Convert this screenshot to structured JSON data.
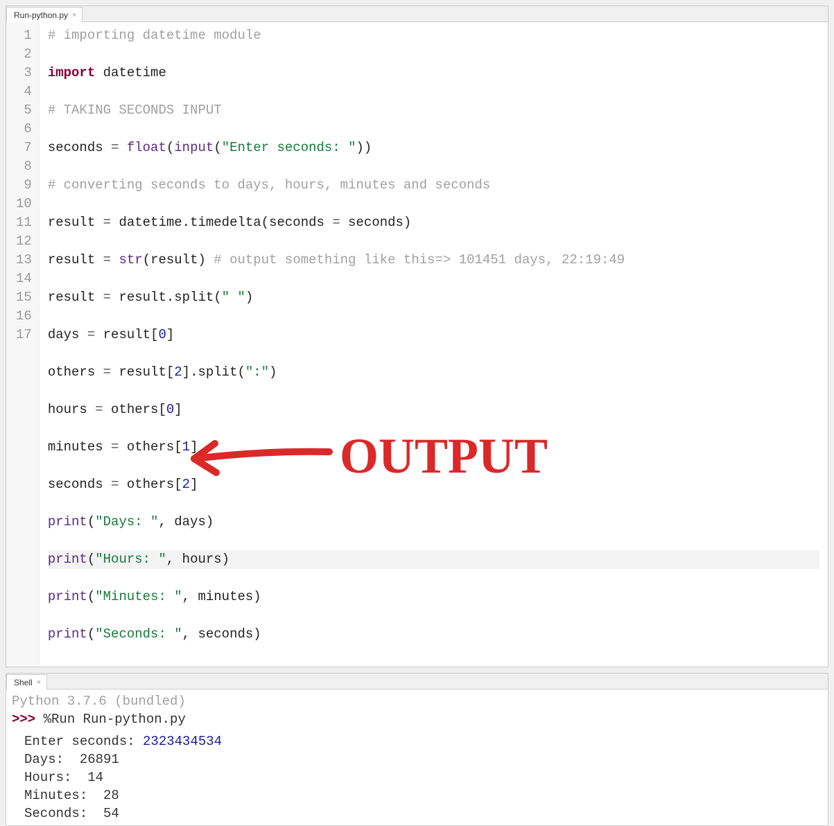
{
  "editor": {
    "tab_label": "Run-python.py",
    "tab_close": "×",
    "gutter": [
      "1",
      "2",
      "3",
      "4",
      "5",
      "6",
      "7",
      "8",
      "9",
      "10",
      "11",
      "12",
      "13",
      "14",
      "15",
      "16",
      "17"
    ],
    "lines": [
      {
        "t": [
          {
            "c": "c-comment",
            "v": "# importing datetime module"
          }
        ]
      },
      {
        "t": [
          {
            "c": "c-keyword",
            "v": "import"
          },
          {
            "c": "c-text",
            "v": " datetime"
          }
        ]
      },
      {
        "t": [
          {
            "c": "c-comment",
            "v": "# TAKING SECONDS INPUT"
          }
        ]
      },
      {
        "t": [
          {
            "c": "c-text",
            "v": "seconds "
          },
          {
            "c": "c-op",
            "v": "="
          },
          {
            "c": "c-text",
            "v": " "
          },
          {
            "c": "c-builtin",
            "v": "float"
          },
          {
            "c": "c-text",
            "v": "("
          },
          {
            "c": "c-builtin",
            "v": "input"
          },
          {
            "c": "c-text",
            "v": "("
          },
          {
            "c": "c-string",
            "v": "\"Enter seconds: \""
          },
          {
            "c": "c-text",
            "v": "))"
          }
        ]
      },
      {
        "t": [
          {
            "c": "c-comment",
            "v": "# converting seconds to days, hours, minutes and seconds"
          }
        ]
      },
      {
        "t": [
          {
            "c": "c-text",
            "v": "result "
          },
          {
            "c": "c-op",
            "v": "="
          },
          {
            "c": "c-text",
            "v": " datetime.timedelta(seconds "
          },
          {
            "c": "c-op",
            "v": "="
          },
          {
            "c": "c-text",
            "v": " seconds)"
          }
        ]
      },
      {
        "t": [
          {
            "c": "c-text",
            "v": "result "
          },
          {
            "c": "c-op",
            "v": "="
          },
          {
            "c": "c-text",
            "v": " "
          },
          {
            "c": "c-builtin",
            "v": "str"
          },
          {
            "c": "c-text",
            "v": "(result) "
          },
          {
            "c": "c-comment",
            "v": "# output something like this=> 101451 days, 22:19:49"
          }
        ]
      },
      {
        "t": [
          {
            "c": "c-text",
            "v": "result "
          },
          {
            "c": "c-op",
            "v": "="
          },
          {
            "c": "c-text",
            "v": " result.split("
          },
          {
            "c": "c-string",
            "v": "\" \""
          },
          {
            "c": "c-text",
            "v": ")"
          }
        ]
      },
      {
        "t": [
          {
            "c": "c-text",
            "v": "days "
          },
          {
            "c": "c-op",
            "v": "="
          },
          {
            "c": "c-text",
            "v": " result["
          },
          {
            "c": "c-number",
            "v": "0"
          },
          {
            "c": "c-text",
            "v": "]"
          }
        ]
      },
      {
        "t": [
          {
            "c": "c-text",
            "v": "others "
          },
          {
            "c": "c-op",
            "v": "="
          },
          {
            "c": "c-text",
            "v": " result["
          },
          {
            "c": "c-number",
            "v": "2"
          },
          {
            "c": "c-text",
            "v": "].split("
          },
          {
            "c": "c-string",
            "v": "\":\""
          },
          {
            "c": "c-text",
            "v": ")"
          }
        ]
      },
      {
        "t": [
          {
            "c": "c-text",
            "v": "hours "
          },
          {
            "c": "c-op",
            "v": "="
          },
          {
            "c": "c-text",
            "v": " others["
          },
          {
            "c": "c-number",
            "v": "0"
          },
          {
            "c": "c-text",
            "v": "]"
          }
        ]
      },
      {
        "t": [
          {
            "c": "c-text",
            "v": "minutes "
          },
          {
            "c": "c-op",
            "v": "="
          },
          {
            "c": "c-text",
            "v": " others["
          },
          {
            "c": "c-number",
            "v": "1"
          },
          {
            "c": "c-text",
            "v": "]"
          }
        ]
      },
      {
        "t": [
          {
            "c": "c-text",
            "v": "seconds "
          },
          {
            "c": "c-op",
            "v": "="
          },
          {
            "c": "c-text",
            "v": " others["
          },
          {
            "c": "c-number",
            "v": "2"
          },
          {
            "c": "c-text",
            "v": "]"
          }
        ]
      },
      {
        "t": [
          {
            "c": "c-builtin",
            "v": "print"
          },
          {
            "c": "c-text",
            "v": "("
          },
          {
            "c": "c-string",
            "v": "\"Days: \""
          },
          {
            "c": "c-text",
            "v": ", days)"
          }
        ]
      },
      {
        "current": true,
        "t": [
          {
            "c": "c-builtin",
            "v": "print"
          },
          {
            "c": "c-text",
            "v": "("
          },
          {
            "c": "c-string",
            "v": "\"Hours: \""
          },
          {
            "c": "c-text",
            "v": ", hours)"
          }
        ]
      },
      {
        "t": [
          {
            "c": "c-builtin",
            "v": "print"
          },
          {
            "c": "c-text",
            "v": "("
          },
          {
            "c": "c-string",
            "v": "\"Minutes: \""
          },
          {
            "c": "c-text",
            "v": ", minutes)"
          }
        ]
      },
      {
        "t": [
          {
            "c": "c-builtin",
            "v": "print"
          },
          {
            "c": "c-text",
            "v": "("
          },
          {
            "c": "c-string",
            "v": "\"Seconds: \""
          },
          {
            "c": "c-text",
            "v": ", seconds)"
          }
        ]
      }
    ]
  },
  "shell": {
    "tab_label": "Shell",
    "tab_close": "×",
    "version": "Python 3.7.6 (bundled)",
    "prompt": ">>> ",
    "command": "%Run Run-python.py",
    "output": [
      {
        "label": "Enter seconds: ",
        "value": "2323434534",
        "value_class": "sh-input"
      },
      {
        "label": "Days:  ",
        "value": "26891"
      },
      {
        "label": "Hours:  ",
        "value": "14"
      },
      {
        "label": "Minutes:  ",
        "value": "28"
      },
      {
        "label": "Seconds:  ",
        "value": "54"
      }
    ]
  },
  "annotation": {
    "text": "OUTPUT"
  }
}
